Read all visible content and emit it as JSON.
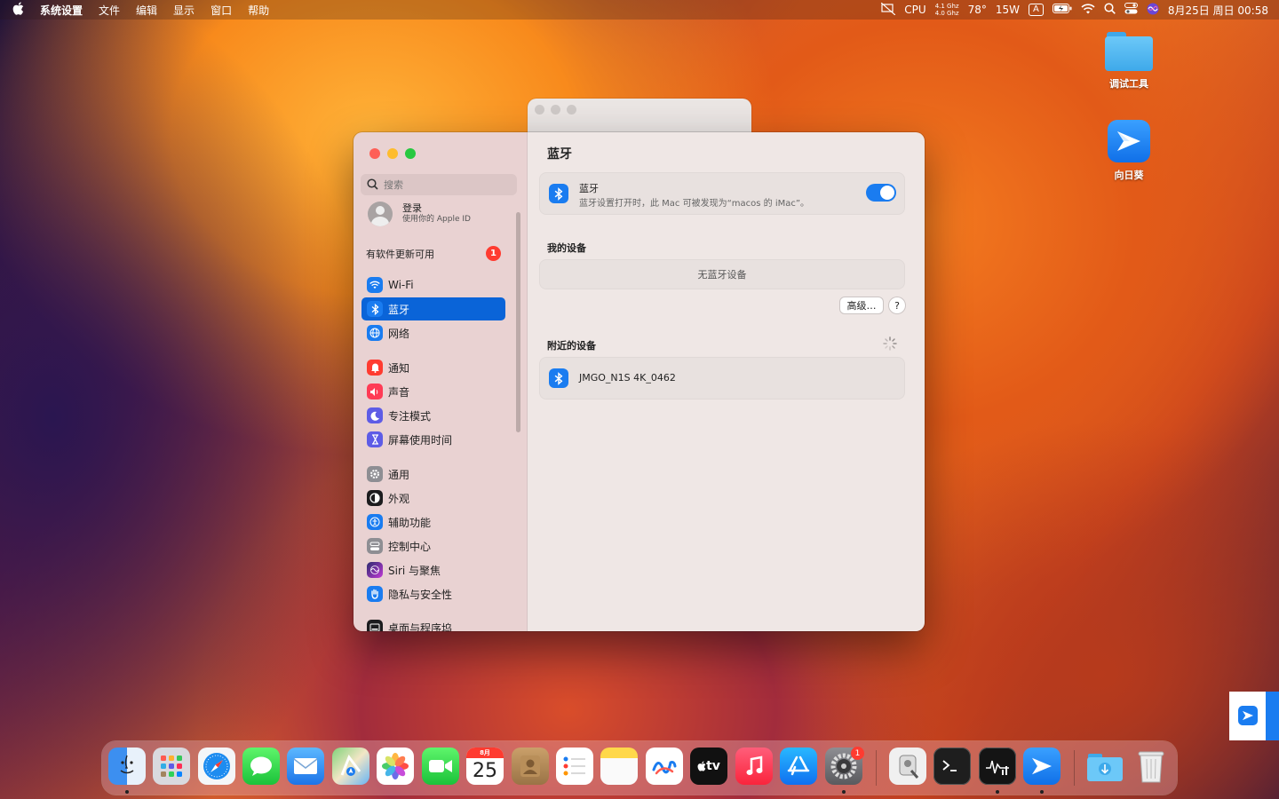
{
  "menubar": {
    "apple": "",
    "app_name": "系统设置",
    "menus": [
      "文件",
      "编辑",
      "显示",
      "窗口",
      "帮助"
    ],
    "cpu_label": "CPU",
    "cpu_freq_1": "4.1 Ghz",
    "cpu_freq_2": "4.0 Ghz",
    "temperature": "78°",
    "power": "15W",
    "input_method": "A",
    "datetime": "8月25日 周日 00:58"
  },
  "desktop": {
    "icons": [
      {
        "label": "调试工具",
        "icon": "folder-icon"
      },
      {
        "label": "向日葵",
        "icon": "sunlogin-icon"
      }
    ]
  },
  "sidebar": {
    "search_placeholder": "搜索",
    "account_title": "登录",
    "account_subtitle": "使用你的 Apple ID",
    "update_label": "有软件更新可用",
    "update_badge": "1",
    "items": [
      {
        "label": "Wi-Fi",
        "icon": "wifi-icon",
        "color": "#1a7cf0"
      },
      {
        "label": "蓝牙",
        "icon": "bluetooth-icon",
        "color": "#1a7cf0"
      },
      {
        "label": "网络",
        "icon": "globe-icon",
        "color": "#1a7cf0"
      },
      {
        "label": "通知",
        "icon": "bell-icon",
        "color": "#ff3b30"
      },
      {
        "label": "声音",
        "icon": "speaker-icon",
        "color": "#ff3b55"
      },
      {
        "label": "专注模式",
        "icon": "moon-icon",
        "color": "#5e5ce6"
      },
      {
        "label": "屏幕使用时间",
        "icon": "hourglass-icon",
        "color": "#5e5ce6"
      },
      {
        "label": "通用",
        "icon": "gear-icon",
        "color": "#8e8e93"
      },
      {
        "label": "外观",
        "icon": "appearance-icon",
        "color": "#1c1c1e"
      },
      {
        "label": "辅助功能",
        "icon": "accessibility-icon",
        "color": "#1a7cf0"
      },
      {
        "label": "控制中心",
        "icon": "toggles-icon",
        "color": "#8e8e93"
      },
      {
        "label": "Siri 与聚焦",
        "icon": "siri-icon",
        "color": "#6b2fbf"
      },
      {
        "label": "隐私与安全性",
        "icon": "hand-icon",
        "color": "#1a7cf0"
      },
      {
        "label": "桌面与程序坞",
        "icon": "dock-icon",
        "color": "#1c1c1e"
      }
    ]
  },
  "content": {
    "title": "蓝牙",
    "bt_title": "蓝牙",
    "bt_desc": "蓝牙设置打开时，此 Mac 可被发现为“macos 的 iMac”。",
    "bt_enabled": true,
    "my_devices_label": "我的设备",
    "no_devices": "无蓝牙设备",
    "advanced_button": "高级…",
    "help_button": "?",
    "nearby_label": "附近的设备",
    "nearby_devices": [
      {
        "name": "JMGO_N1S 4K_0462"
      }
    ]
  },
  "dock": {
    "calendar_month": "8月",
    "calendar_day": "25",
    "settings_badge": "1",
    "appletv_label": "tv"
  }
}
